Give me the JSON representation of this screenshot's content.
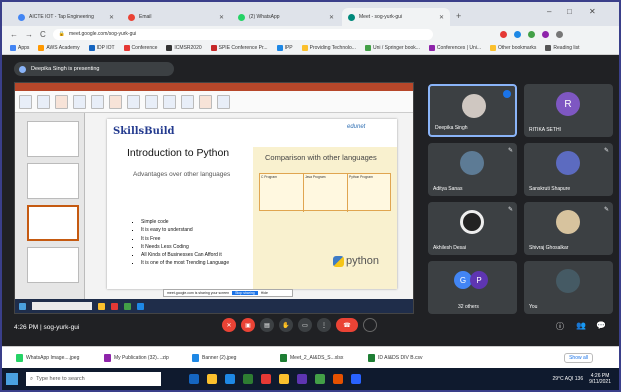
{
  "browser": {
    "tabs": [
      {
        "label": "AICTE IOT - Tap Engineering",
        "color": "#4285f4",
        "active": false
      },
      {
        "label": "Email",
        "color": "#ea4335",
        "active": false
      },
      {
        "label": "(2) WhatsApp",
        "color": "#25d366",
        "active": false
      },
      {
        "label": "Meet - sog-yurk-gui",
        "color": "#00897b",
        "active": true
      }
    ],
    "new_tab": "+",
    "window_controls": [
      "–",
      "□",
      "✕"
    ],
    "url": "meet.google.com/sog-yurk-gui",
    "nav": [
      "←",
      "→",
      "C"
    ],
    "bookmarks": [
      {
        "label": "Apps",
        "color": "#4285f4"
      },
      {
        "label": "AWS Academy",
        "color": "#ff9900"
      },
      {
        "label": "IDP IOT",
        "color": "#1565c0"
      },
      {
        "label": "Conference",
        "color": "#e53935"
      },
      {
        "label": "ICMSR2020",
        "color": "#333333"
      },
      {
        "label": "SPIE Conference Pr...",
        "color": "#c62828"
      },
      {
        "label": "IPP",
        "color": "#1e88e5"
      },
      {
        "label": "Providing Technolo...",
        "color": "#fbc02d"
      },
      {
        "label": "Uni / Springer book...",
        "color": "#43a047"
      },
      {
        "label": "Conferences | Uni...",
        "color": "#8e24aa"
      },
      {
        "label": "Other bookmarks",
        "color": "#fbc02d"
      },
      {
        "label": "Reading list",
        "color": "#555555"
      }
    ]
  },
  "meet": {
    "presenting_text": "Deepika Singh is presenting",
    "time_code": "4:26 PM | sog-yurk-gui",
    "participants": [
      {
        "name": "Deepika Singh",
        "avatar_color": "#cfc7c1",
        "highlight": true
      },
      {
        "name": "RITIKA SETHI",
        "avatar_color": "#7e57c2",
        "initial": "R"
      },
      {
        "name": "Aditya Sanas",
        "avatar_color": "#5d7b95"
      },
      {
        "name": "Sanskruti Shapure",
        "avatar_color": "#5c6bc0"
      },
      {
        "name": "Akhilesh Desai",
        "avatar_color": "#222222"
      },
      {
        "name": "Shivraj Ghosalkar",
        "avatar_color": "#d7c39e"
      },
      {
        "name": "32 others",
        "avatar_color": "#4285f4",
        "initials": [
          "G",
          "P"
        ]
      },
      {
        "name": "You",
        "avatar_color": "#455a64"
      }
    ],
    "controls": [
      "mic-off",
      "cam-off",
      "captions",
      "raise-hand",
      "present",
      "more",
      "end-call"
    ],
    "right_controls": [
      "ⓘ",
      "👥",
      "💬"
    ]
  },
  "slide": {
    "brand": "SkillsBuild",
    "partner": "edunet",
    "title": "Introduction to Python",
    "subtitle": "Advantages over other languages",
    "bullets": [
      "Simple code",
      "It is easy to understand",
      "It is Free",
      "It Needs Less Coding",
      "All Kinds of Businesses Can Afford it",
      "It is one of the most Trending Language"
    ],
    "comparison_title": "Comparison with other languages",
    "comparison_columns": [
      "C Program",
      "Java Program",
      "Python Program"
    ],
    "python_logo_text": "python",
    "share_bar": {
      "text": "meet.google.com is sharing your screen",
      "stop": "Stop sharing",
      "hide": "Hide"
    }
  },
  "downloads": [
    {
      "label": "WhatsApp Image....jpeg",
      "color": "#25d366"
    },
    {
      "label": "My Publication (32)....zip",
      "color": "#8e24aa"
    },
    {
      "label": "Banner (2).jpeg",
      "color": "#1e88e5"
    },
    {
      "label": "Meet_2_AI&DS_S...xlsx",
      "color": "#1e7e34"
    },
    {
      "label": "ID AI&DS DIV B.csv",
      "color": "#1e7e34"
    }
  ],
  "downloads_show_all": "Show all",
  "taskbar": {
    "search_placeholder": "Type here to search",
    "apps": [
      "#1565c0",
      "#fbc02d",
      "#1e88e5",
      "#2e7d32",
      "#e53935",
      "#fbc02d",
      "#5e35b1",
      "#43a047",
      "#e65100",
      "#2962ff"
    ],
    "tray": {
      "weather": "29°C  AQI 136",
      "time": "4:26 PM",
      "date": "9/11/2021"
    }
  }
}
